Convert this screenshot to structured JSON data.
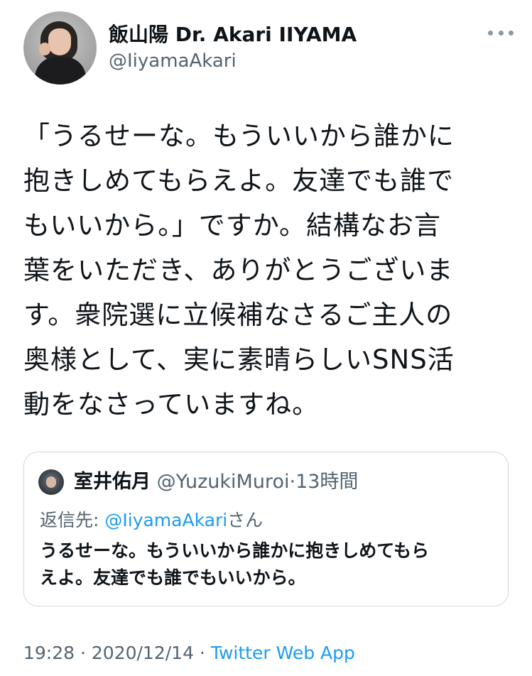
{
  "author": {
    "display_name": "飯山陽 Dr. Akari IIYAMA",
    "handle": "@IiyamaAkari"
  },
  "tweet": {
    "lines": [
      "「うるせーな。もういいから誰かに",
      "抱きしめてもらえよ。友達でも誰で",
      "もいいから。」ですか。結構なお言",
      "葉をいただき、ありがとうございま",
      "す。衆院選に立候補なさるご主人の",
      "奥様として、実に素晴らしいSNS活",
      "動をなさっていますね。"
    ]
  },
  "quoted": {
    "display_name": "室井佑月",
    "handle": "@YuzukiMuroi",
    "separator": "·",
    "time": "13時間",
    "reply_prefix": "返信先: ",
    "reply_handle": "@IiyamaAkari",
    "reply_suffix": "さん",
    "lines": [
      "うるせーな。もういいから誰かに抱きしめてもら",
      "えよ。友達でも誰でもいいから。"
    ]
  },
  "meta": {
    "time": "19:28",
    "sep1": " · ",
    "date": "2020/12/14",
    "sep2": " · ",
    "source": "Twitter Web App"
  },
  "colors": {
    "text": "#0f1419",
    "secondary": "#536471",
    "link": "#1d9bf0",
    "border": "#cfd9de"
  },
  "icons": {
    "more": "more-horizontal-icon"
  }
}
